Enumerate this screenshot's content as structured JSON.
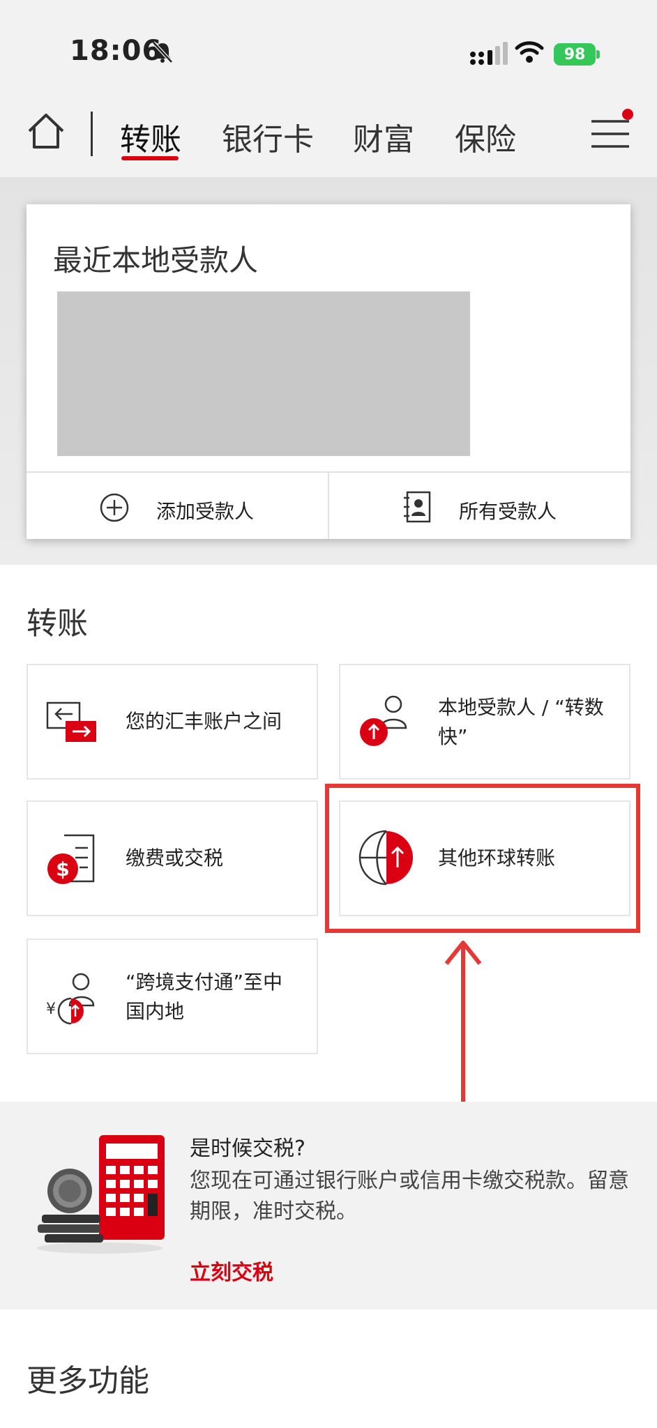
{
  "status_bar": {
    "time": "18:06",
    "battery": "98"
  },
  "nav": {
    "tabs": [
      "转账",
      "银行卡",
      "财富",
      "保险"
    ],
    "active": "转账"
  },
  "payees": {
    "title": "最近本地受款人",
    "add_label": "添加受款人",
    "all_label": "所有受款人"
  },
  "transfer": {
    "heading": "转账",
    "tiles": [
      {
        "label": "您的汇丰账户之间",
        "icon": "account-transfer-icon"
      },
      {
        "label": "本地受款人 / “转数快”",
        "icon": "local-payee-icon"
      },
      {
        "label": "缴费或交税",
        "icon": "bill-payment-icon"
      },
      {
        "label": "其他环球转账",
        "icon": "global-transfer-icon",
        "highlighted": true
      },
      {
        "label": "“跨境支付通”至中国内地",
        "icon": "cross-border-icon"
      }
    ]
  },
  "tax_banner": {
    "title": "是时候交税?",
    "description": "您现在可通过银行账户或信用卡缴交税款。留意期限，准时交税。",
    "link": "立刻交税"
  },
  "more": {
    "heading": "更多功能"
  },
  "colors": {
    "accent": "#db0011",
    "highlight": "#e53935"
  }
}
